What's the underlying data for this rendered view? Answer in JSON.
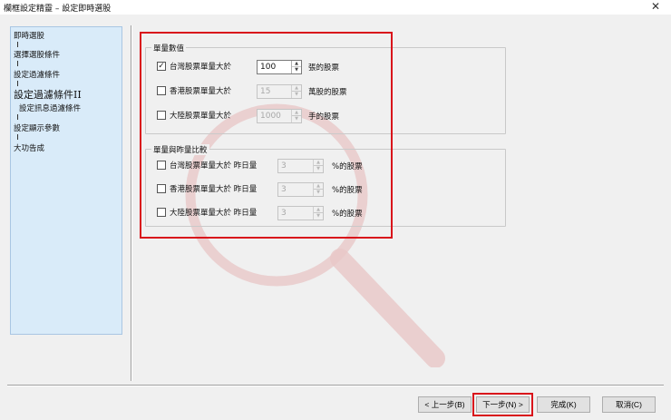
{
  "window": {
    "title": "欄框設定精靈 – 設定即時選股",
    "close_glyph": "✕"
  },
  "sidebar": {
    "steps": [
      {
        "label": "即時選股"
      },
      {
        "label": "選擇選股條件"
      },
      {
        "label": "設定過濾條件"
      },
      {
        "label": "設定過濾條件II"
      },
      {
        "label": "設定訊息過濾條件"
      },
      {
        "label": "設定顯示參數"
      },
      {
        "label": "大功告成"
      }
    ]
  },
  "volume_values": {
    "title": "單量數值",
    "rows": [
      {
        "label": "台灣股票單量大於",
        "value": "100",
        "unit": "張的股票",
        "checked": true,
        "enabled": true
      },
      {
        "label": "香港股票單量大於",
        "value": "15",
        "unit": "萬股的股票",
        "checked": false,
        "enabled": false
      },
      {
        "label": "大陸股票單量大於",
        "value": "1000",
        "unit": "手的股票",
        "checked": false,
        "enabled": false
      }
    ]
  },
  "volume_ratio": {
    "title": "單量與昨量比較",
    "rows": [
      {
        "label": "台灣股票單量大於 昨日量",
        "value": "3",
        "unit": "%的股票",
        "checked": false,
        "enabled": false
      },
      {
        "label": "香港股票單量大於 昨日量",
        "value": "3",
        "unit": "%的股票",
        "checked": false,
        "enabled": false
      },
      {
        "label": "大陸股票單量大於 昨日量",
        "value": "3",
        "unit": "%的股票",
        "checked": false,
        "enabled": false
      }
    ]
  },
  "checkbox_glyph": "✓",
  "spin_up_glyph": "▲",
  "spin_down_glyph": "▼",
  "highlight_color": "#d9141b",
  "buttons": {
    "back": "< 上一步(B)",
    "next": "下一步(N) >",
    "finish": "完成(K)",
    "cancel": "取消(C)"
  }
}
